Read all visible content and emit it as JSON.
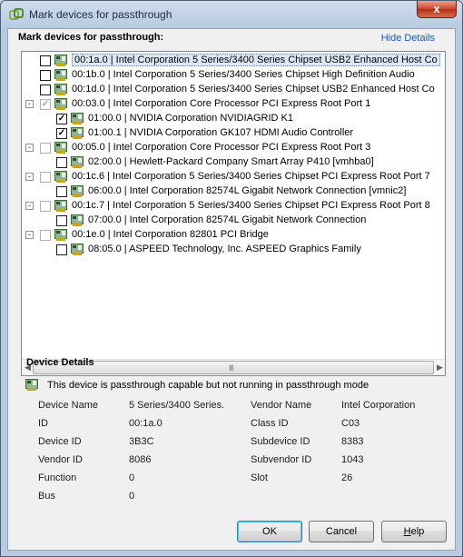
{
  "window": {
    "title": "Mark devices for passthrough",
    "close_label": "x",
    "icon": "vsphere-logo-icon"
  },
  "section": {
    "header": "Mark devices for passthrough:",
    "hide_details": "Hide Details"
  },
  "tree": {
    "rows": [
      {
        "level": 0,
        "expander": "",
        "checked": false,
        "disabled": false,
        "selected": true,
        "label": "00:1a.0 | Intel Corporation 5 Series/3400 Series Chipset USB2 Enhanced Host Co"
      },
      {
        "level": 0,
        "expander": "",
        "checked": false,
        "disabled": false,
        "selected": false,
        "label": "00:1b.0 | Intel Corporation 5 Series/3400 Series Chipset High Definition Audio"
      },
      {
        "level": 0,
        "expander": "",
        "checked": false,
        "disabled": false,
        "selected": false,
        "label": "00:1d.0 | Intel Corporation 5 Series/3400 Series Chipset USB2 Enhanced Host Co"
      },
      {
        "level": 0,
        "expander": "-",
        "checked": true,
        "disabled": true,
        "selected": false,
        "label": "00:03.0 | Intel Corporation Core Processor PCI Express Root Port 1"
      },
      {
        "level": 1,
        "expander": "",
        "checked": true,
        "disabled": false,
        "selected": false,
        "label": "01:00.0 | NVIDIA Corporation NVIDIAGRID K1"
      },
      {
        "level": 1,
        "expander": "",
        "checked": true,
        "disabled": false,
        "selected": false,
        "label": "01:00.1 | NVIDIA Corporation GK107 HDMI Audio Controller"
      },
      {
        "level": 0,
        "expander": "-",
        "checked": false,
        "disabled": true,
        "selected": false,
        "label": "00:05.0 | Intel Corporation Core Processor PCI Express Root Port 3"
      },
      {
        "level": 1,
        "expander": "",
        "checked": false,
        "disabled": false,
        "selected": false,
        "label": "02:00.0 | Hewlett-Packard Company Smart Array P410 [vmhba0]"
      },
      {
        "level": 0,
        "expander": "-",
        "checked": false,
        "disabled": true,
        "selected": false,
        "label": "00:1c.6 | Intel Corporation 5 Series/3400 Series Chipset PCI Express Root Port 7"
      },
      {
        "level": 1,
        "expander": "",
        "checked": false,
        "disabled": false,
        "selected": false,
        "label": "06:00.0 | Intel Corporation 82574L Gigabit Network Connection [vmnic2]"
      },
      {
        "level": 0,
        "expander": "-",
        "checked": false,
        "disabled": true,
        "selected": false,
        "label": "00:1c.7 | Intel Corporation 5 Series/3400 Series Chipset PCI Express Root Port 8"
      },
      {
        "level": 1,
        "expander": "",
        "checked": false,
        "disabled": false,
        "selected": false,
        "label": "07:00.0 | Intel Corporation 82574L Gigabit Network Connection"
      },
      {
        "level": 0,
        "expander": "-",
        "checked": false,
        "disabled": true,
        "selected": false,
        "label": "00:1e.0 | Intel Corporation 82801 PCI Bridge"
      },
      {
        "level": 1,
        "expander": "",
        "checked": false,
        "disabled": false,
        "selected": false,
        "label": "08:05.0 | ASPEED Technology, Inc. ASPEED Graphics Family"
      }
    ],
    "scroll_grip": "III"
  },
  "details": {
    "title": "Device Details",
    "status": "This device is passthrough capable but not running in passthrough mode",
    "left": [
      {
        "key": "Device Name",
        "value": "5 Series/3400 Series."
      },
      {
        "key": "ID",
        "value": "00:1a.0"
      },
      {
        "key": "Device ID",
        "value": "3B3C"
      },
      {
        "key": "Vendor ID",
        "value": "8086"
      },
      {
        "key": "Function",
        "value": "0"
      },
      {
        "key": "Bus",
        "value": "0"
      }
    ],
    "right": [
      {
        "key": "Vendor Name",
        "value": "Intel Corporation"
      },
      {
        "key": "Class ID",
        "value": "C03"
      },
      {
        "key": "Subdevice ID",
        "value": "8383"
      },
      {
        "key": "Subvendor ID",
        "value": "1043"
      },
      {
        "key": "Slot",
        "value": "26"
      }
    ]
  },
  "buttons": {
    "ok": "OK",
    "cancel": "Cancel",
    "help": "Help"
  },
  "colors": {
    "selection": "#dbe8f7",
    "link": "#1a56c6",
    "title_close": "#c8452f"
  }
}
